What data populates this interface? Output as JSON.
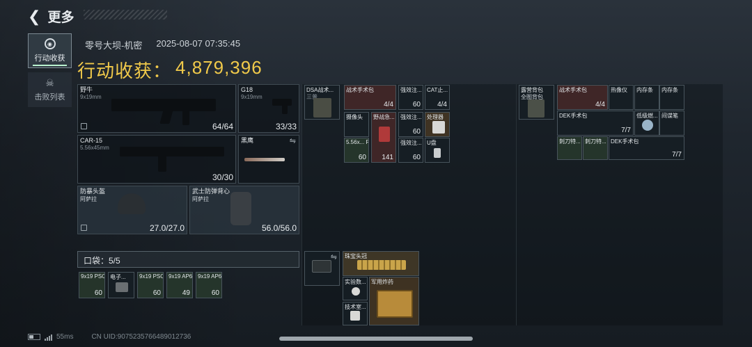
{
  "header": {
    "back_label": "更多"
  },
  "tabs": [
    {
      "label": "行动收获"
    },
    {
      "label": "击败列表"
    }
  ],
  "meta": {
    "map": "零号大坝-机密",
    "datetime": "2025-08-07 07:35:45"
  },
  "title": {
    "label": "行动收获：",
    "value": "4,879,396"
  },
  "weapons": [
    {
      "name": "野牛",
      "ammo": "9x19mm",
      "count": "64/64"
    },
    {
      "name": "G18",
      "ammo": "9x19mm",
      "count": "33/33"
    },
    {
      "name": "CAR-15",
      "ammo": "5.56x45mm",
      "count": "30/30"
    },
    {
      "name": "黑鹰",
      "ammo": "",
      "count": ""
    }
  ],
  "armor": [
    {
      "name": "防暴头盔",
      "sub": "阿萨拉",
      "count": "27.0/27.0"
    },
    {
      "name": "武士防弹背心",
      "sub": "阿萨拉",
      "count": "56.0/56.0"
    }
  ],
  "pocket": {
    "label": "口袋：5/5",
    "items": [
      {
        "name": "9x19 PSO",
        "count": "60"
      },
      {
        "name": "电子...",
        "count": ""
      },
      {
        "name": "9x19 PSO",
        "count": "60"
      },
      {
        "name": "9x19 AP6.3",
        "count": "49"
      },
      {
        "name": "9x19 AP6.3",
        "count": "60"
      }
    ]
  },
  "rig": {
    "name": "DSA战术...",
    "sub": "三普"
  },
  "rig_items": [
    {
      "name": "战术手术包",
      "count": "4/4"
    },
    {
      "name": "强效注...",
      "count": "60"
    },
    {
      "name": "CAT止...",
      "count": "4/4"
    },
    {
      "name": "摄像头",
      "count": ""
    },
    {
      "name": "野战急...",
      "count": "141"
    },
    {
      "name": "强效注...",
      "count": "60"
    },
    {
      "name": "处理器",
      "count": ""
    },
    {
      "name": "5.56x... FMJ",
      "count": "60"
    },
    {
      "name": "强效注...",
      "count": "60"
    },
    {
      "name": "U盘",
      "count": ""
    }
  ],
  "backpack_slot": {
    "name": ""
  },
  "backpack_items": [
    {
      "name": "珠宝头冠",
      "count": ""
    },
    {
      "name": "实验数...",
      "count": ""
    },
    {
      "name": "军用炸药",
      "count": ""
    },
    {
      "name": "技术室...",
      "count": ""
    }
  ],
  "bag": {
    "name": "露营背包",
    "sub": "全图背包"
  },
  "bag_items": [
    {
      "name": "战术手术包",
      "count": "4/4"
    },
    {
      "name": "热像仪",
      "count": ""
    },
    {
      "name": "内存条",
      "count": ""
    },
    {
      "name": "内存条",
      "count": ""
    },
    {
      "name": "DEK手术包",
      "count": "7/7"
    },
    {
      "name": "低级燃...",
      "count": ""
    },
    {
      "name": "间谍笔",
      "count": ""
    },
    {
      "name": "刺刀特...",
      "count": ""
    },
    {
      "name": "刺刀特...",
      "count": ""
    },
    {
      "name": "DEK手术包",
      "count": "7/7"
    }
  ],
  "status": {
    "ping": "55ms",
    "uid": "CN UID:9075235766489012736"
  }
}
